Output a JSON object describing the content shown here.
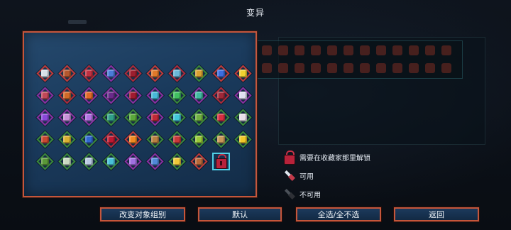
{
  "title": "变异",
  "colors": {
    "panel_border": "#c4563c",
    "panel_fill": "#1a3a5c",
    "selected_outline": "#4fd0e6",
    "lock_red": "#b8223a"
  },
  "grid": {
    "rows": [
      [
        {
          "icon": "sword-blood-icon",
          "frame": "#c23a3a",
          "color": "#d9dfe8"
        },
        {
          "icon": "crossed-axes-icon",
          "frame": "#c23a3a",
          "color": "#b3572e"
        },
        {
          "icon": "spiked-claw-icon",
          "frame": "#b02a3a",
          "color": "#c03040"
        },
        {
          "icon": "blue-blade-icon",
          "frame": "#8b2fa3",
          "color": "#4a7ad8"
        },
        {
          "icon": "red-orb-icon",
          "frame": "#b02a3a",
          "color": "#9c1e2e"
        },
        {
          "icon": "fire-pot-icon",
          "frame": "#c23a3a",
          "color": "#e0782a"
        },
        {
          "icon": "rainbow-wave-icon",
          "frame": "#b02a3a",
          "color": "#6ab8d8"
        },
        {
          "icon": "golden-shield-icon",
          "frame": "#3a8a3a",
          "color": "#d8a030"
        },
        {
          "icon": "blue-potion-icon",
          "frame": "#c23a3a",
          "color": "#3c6ce0"
        },
        {
          "icon": "lightning-bolt-icon",
          "frame": "#c23a3a",
          "color": "#f0d030"
        }
      ],
      [
        {
          "icon": "armored-fist-icon",
          "frame": "#8b2fa3",
          "color": "#c04858"
        },
        {
          "icon": "striped-banner-icon",
          "frame": "#b02a3a",
          "color": "#d06a28"
        },
        {
          "icon": "fire-ring-icon",
          "frame": "#8b2fa3",
          "color": "#e06828"
        },
        {
          "icon": "shadow-gem-icon",
          "frame": "#8b2fa3",
          "color": "#6a2a8a"
        },
        {
          "icon": "blood-star-icon",
          "frame": "#8b2fa3",
          "color": "#a01a30"
        },
        {
          "icon": "trident-icon",
          "frame": "#8b2fa3",
          "color": "#48b8d8"
        },
        {
          "icon": "up-arrows-icon",
          "frame": "#3a8a3a",
          "color": "#40c060"
        },
        {
          "icon": "twin-crystals-icon",
          "frame": "#8b2fa3",
          "color": "#40b8a0"
        },
        {
          "icon": "magma-orb-icon",
          "frame": "#b02a3a",
          "color": "#a02838"
        },
        {
          "icon": "music-note-icon",
          "frame": "#8b2fa3",
          "color": "#e0e0f0"
        }
      ],
      [
        {
          "icon": "violet-dagger-icon",
          "frame": "#8b2fa3",
          "color": "#8a48d8"
        },
        {
          "icon": "striped-scroll-icon",
          "frame": "#8b2fa3",
          "color": "#c890d8"
        },
        {
          "icon": "purple-saber-icon",
          "frame": "#8b2fa3",
          "color": "#b070e0"
        },
        {
          "icon": "vortex-rune-icon",
          "frame": "#3a8a3a",
          "color": "#30a088"
        },
        {
          "icon": "green-egg-icon",
          "frame": "#3a8a3a",
          "color": "#5aa83a"
        },
        {
          "icon": "demon-mask-icon",
          "frame": "#8b2fa3",
          "color": "#c02838"
        },
        {
          "icon": "cyan-seal-icon",
          "frame": "#3a8a3a",
          "color": "#40c8d8"
        },
        {
          "icon": "moss-ring-icon",
          "frame": "#3a8a3a",
          "color": "#70b040"
        },
        {
          "icon": "heal-cross-icon",
          "frame": "#3a8a3a",
          "color": "#d83040"
        },
        {
          "icon": "fang-maw-icon",
          "frame": "#3a8a3a",
          "color": "#e8e0e8"
        }
      ],
      [
        {
          "icon": "flame-gauntlet-icon",
          "frame": "#3a8a3a",
          "color": "#c84830"
        },
        {
          "icon": "golden-feather-icon",
          "frame": "#3a8a3a",
          "color": "#d8b030"
        },
        {
          "icon": "blue-flask-icon",
          "frame": "#3a8a3a",
          "color": "#3068d0"
        },
        {
          "icon": "blood-drop-icon",
          "frame": "#b02a3a",
          "color": "#c01830"
        },
        {
          "icon": "double-chevron-icon",
          "frame": "#c23a3a",
          "color": "#f08a20"
        },
        {
          "icon": "barrel-icon",
          "frame": "#3a8a3a",
          "color": "#b88040"
        },
        {
          "icon": "red-sigil-icon",
          "frame": "#3a8a3a",
          "color": "#c83838"
        },
        {
          "icon": "lime-coil-icon",
          "frame": "#3a8a3a",
          "color": "#98c838"
        },
        {
          "icon": "tan-orb-icon",
          "frame": "#3a8a3a",
          "color": "#c89858"
        },
        {
          "icon": "yellow-chevron-icon",
          "frame": "#3a8a3a",
          "color": "#f0c828"
        }
      ],
      [
        {
          "icon": "green-skull-icon",
          "frame": "#3a8a3a",
          "color": "#5a9838"
        },
        {
          "icon": "pale-skull-icon",
          "frame": "#3a8a3a",
          "color": "#c8d8c0"
        },
        {
          "icon": "ghost-face-icon",
          "frame": "#3a8a3a",
          "color": "#b8c8e0"
        },
        {
          "icon": "cyan-crown-icon",
          "frame": "#3a8a3a",
          "color": "#48c0d8"
        },
        {
          "icon": "violet-bubble-icon",
          "frame": "#8b2fa3",
          "color": "#a070e0"
        },
        {
          "icon": "orb-wand-icon",
          "frame": "#8b2fa3",
          "color": "#5088d8"
        },
        {
          "icon": "sparkle-burst-icon",
          "frame": "#3a8a3a",
          "color": "#f0c838"
        },
        {
          "icon": "spiked-ball-icon",
          "frame": "#c23a3a",
          "color": "#b86838"
        },
        {
          "icon": "lock-icon",
          "locked": true,
          "selected": true
        }
      ]
    ]
  },
  "legend": {
    "locked_label": "需要在收藏家那里解锁",
    "available_label": "可用",
    "unavailable_label": "不可用"
  },
  "buttons": {
    "change_group": "改变对象组别",
    "default": "默认",
    "toggle_all": "全选/全不选",
    "back": "返回"
  }
}
